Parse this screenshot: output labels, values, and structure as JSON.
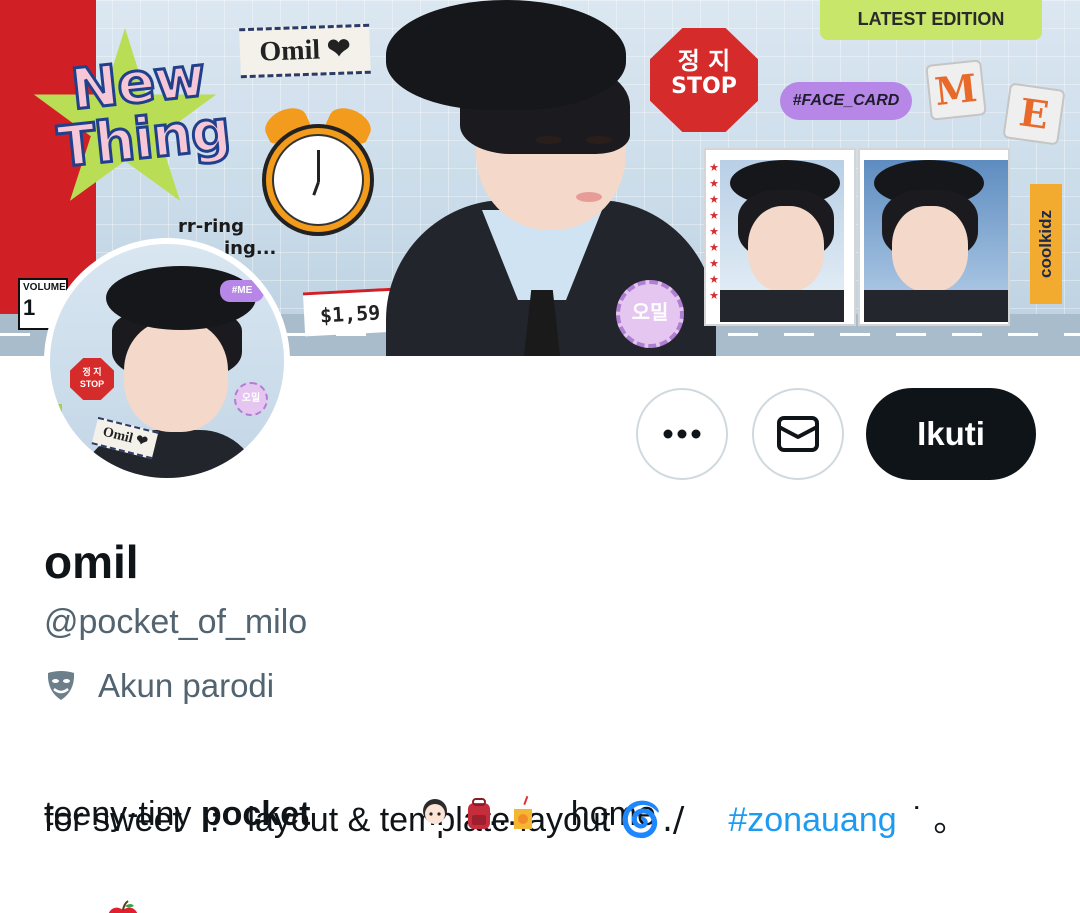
{
  "banner": {
    "sticker_new": "New",
    "sticker_thing": "Thing",
    "sticker_omil": "Omil ❤",
    "sticker_rring": "rr-ring",
    "sticker_ring2": "ing...",
    "volume_label": "VOLUME",
    "volume_number": "1",
    "price": "$1,59",
    "stop_korean": "정 지",
    "stop_english": "STOP",
    "face_card": "#FACE_CARD",
    "latest_edition": "LATEST EDITION",
    "tile_m": "M",
    "tile_e": "E",
    "coolkidz": "coolkidz",
    "badge_omil": "오밀"
  },
  "avatar": {
    "me_tag": "#ME",
    "stop_korean": "정 지",
    "stop_english": "STOP",
    "badge": "오밀",
    "name_tag": "Omil ❤"
  },
  "actions": {
    "more_icon": "more-dots-icon",
    "message_icon": "envelope-icon",
    "follow_label": "Ikuti"
  },
  "profile": {
    "display_name": "omil",
    "handle": "@pocket_of_milo",
    "parody_icon": "theater-mask-icon",
    "parody_label": "Akun parodi"
  },
  "bio": {
    "l1_pre": "teeny-tiny ",
    "l1_bold": "pocket",
    "l1_ellipsis": "...",
    "l1_home": "home",
    "l2_a": "for sweet",
    "l2_colon": ":",
    "l2_b": "layout & template",
    "l2_c": "layout",
    "l2_spiral": "🌀./",
    "l2_hashtag": "#zonauang",
    "l2_tail": "˙ 。",
    "emojis": [
      "girl-emoji",
      "backpack-emoji",
      "juice-box-emoji",
      "apple-emoji"
    ]
  },
  "colors": {
    "text_primary": "#0f1419",
    "text_secondary": "#536471",
    "link": "#1d9bf0",
    "follow_bg": "#0f1419",
    "button_border": "#cfd9de"
  }
}
